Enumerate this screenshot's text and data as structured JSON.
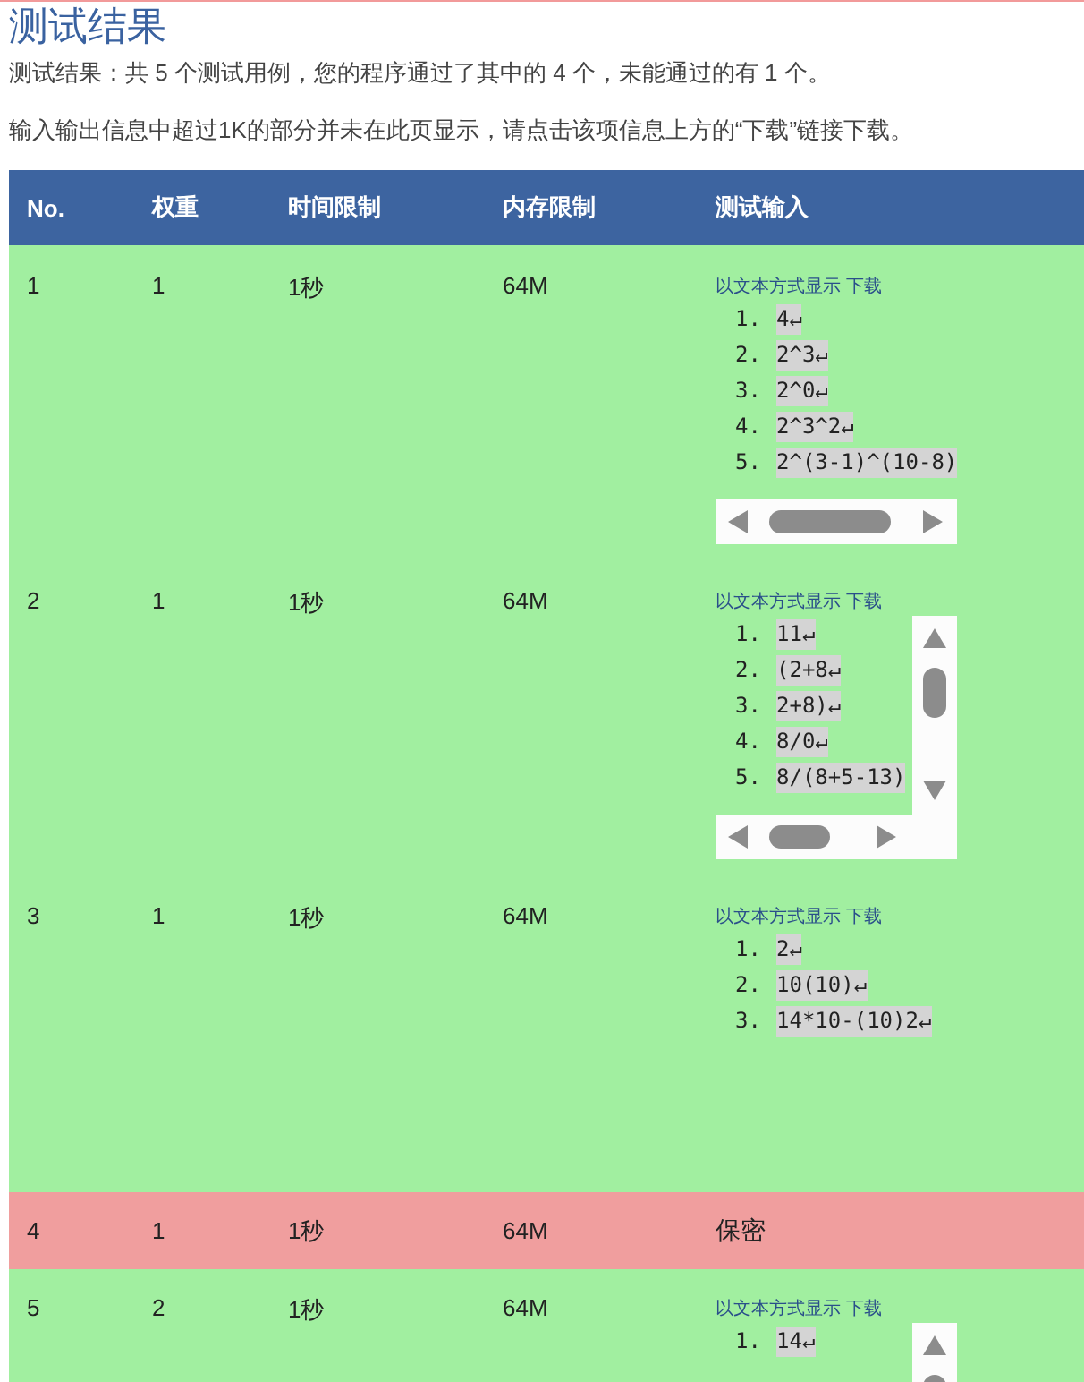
{
  "title": "测试结果",
  "summary": "测试结果：共 5 个测试用例，您的程序通过了其中的 4 个，未能通过的有 1 个。",
  "notice": "输入输出信息中超过1K的部分并未在此页显示，请点击该项信息上方的“下载”链接下载。",
  "table": {
    "columns": [
      "No.",
      "权重",
      "时间限制",
      "内存限制",
      "测试输入"
    ],
    "rows": [
      {
        "no": "1",
        "weight": "1",
        "time": "1秒",
        "memory": "64M",
        "passed": true,
        "input": {
          "kind": "code",
          "scroll_x": true,
          "scroll_y": false,
          "links": [
            "以文本方式显示",
            "下载"
          ],
          "lines": [
            {
              "no": "1.",
              "text": "4↵"
            },
            {
              "no": "2.",
              "text": "2^3↵"
            },
            {
              "no": "3.",
              "text": "2^0↵"
            },
            {
              "no": "4.",
              "text": "2^3^2↵"
            },
            {
              "no": "5.",
              "text": "2^(3-1)^(10-8)"
            }
          ]
        }
      },
      {
        "no": "2",
        "weight": "1",
        "time": "1秒",
        "memory": "64M",
        "passed": true,
        "input": {
          "kind": "code",
          "scroll_x": true,
          "scroll_y": true,
          "links": [
            "以文本方式显示",
            "下载"
          ],
          "lines": [
            {
              "no": "1.",
              "text": "11↵"
            },
            {
              "no": "2.",
              "text": "(2+8↵"
            },
            {
              "no": "3.",
              "text": "2+8)↵"
            },
            {
              "no": "4.",
              "text": "8/0↵"
            },
            {
              "no": "5.",
              "text": "8/(8+5-13)"
            }
          ]
        }
      },
      {
        "no": "3",
        "weight": "1",
        "time": "1秒",
        "memory": "64M",
        "passed": true,
        "input": {
          "kind": "code",
          "scroll_x": false,
          "scroll_y": false,
          "links": [
            "以文本方式显示",
            "下载"
          ],
          "lines": [
            {
              "no": "1.",
              "text": "2↵"
            },
            {
              "no": "2.",
              "text": "10(10)↵"
            },
            {
              "no": "3.",
              "text": "14*10-(10)2↵"
            }
          ]
        }
      },
      {
        "no": "4",
        "weight": "1",
        "time": "1秒",
        "memory": "64M",
        "passed": false,
        "input": {
          "kind": "secret",
          "text": "保密"
        }
      },
      {
        "no": "5",
        "weight": "2",
        "time": "1秒",
        "memory": "64M",
        "passed": true,
        "input": {
          "kind": "code",
          "scroll_x": false,
          "scroll_y": true,
          "links": [
            "以文本方式显示",
            "下载"
          ],
          "lines": [
            {
              "no": "1.",
              "text": "14↵"
            }
          ]
        }
      }
    ]
  }
}
